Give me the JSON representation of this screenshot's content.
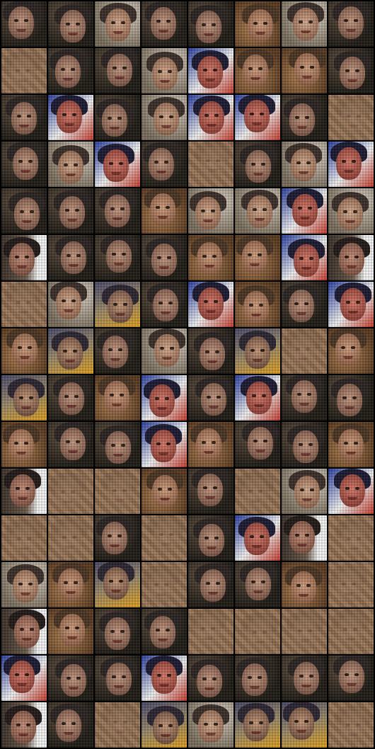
{
  "grid": {
    "columns": 8,
    "rows": 16,
    "tiles": [
      "dark",
      "dark",
      "light",
      "dark",
      "dark",
      "warm",
      "light",
      "dark",
      "blank",
      "dark",
      "dark",
      "light",
      "blue",
      "warm",
      "warm",
      "dark",
      "dark",
      "blue",
      "dark",
      "light",
      "blue",
      "blue",
      "dark",
      "blank",
      "dark",
      "light",
      "blue",
      "dark",
      "blank",
      "dark",
      "light",
      "blue",
      "dark",
      "dark",
      "dark",
      "warm",
      "light",
      "light",
      "blue",
      "light",
      "white",
      "dark",
      "dark",
      "dark",
      "warm",
      "warm",
      "blue",
      "white",
      "blank",
      "light",
      "gold",
      "dark",
      "blue",
      "warm",
      "dark",
      "blue",
      "warm",
      "gold",
      "dark",
      "light",
      "dark",
      "gold",
      "blank",
      "warm",
      "gold",
      "dark",
      "warm",
      "blue",
      "dark",
      "blue",
      "dark",
      "dark",
      "warm",
      "dark",
      "dark",
      "blue",
      "warm",
      "dark",
      "dark",
      "warm",
      "white",
      "blank",
      "blank",
      "warm",
      "dark",
      "blank",
      "light",
      "blue",
      "blank",
      "blank",
      "dark",
      "blank",
      "dark",
      "blue",
      "white",
      "blank",
      "light",
      "warm",
      "gold",
      "blank",
      "dark",
      "dark",
      "warm",
      "blank",
      "white",
      "warm",
      "dark",
      "dark",
      "blank",
      "blank",
      "blank",
      "blank",
      "blue",
      "dark",
      "dark",
      "blue",
      "dark",
      "dark",
      "dark",
      "dark",
      "white",
      "dark",
      "blank",
      "gold",
      "light",
      "gold",
      "gold",
      "blank"
    ]
  }
}
